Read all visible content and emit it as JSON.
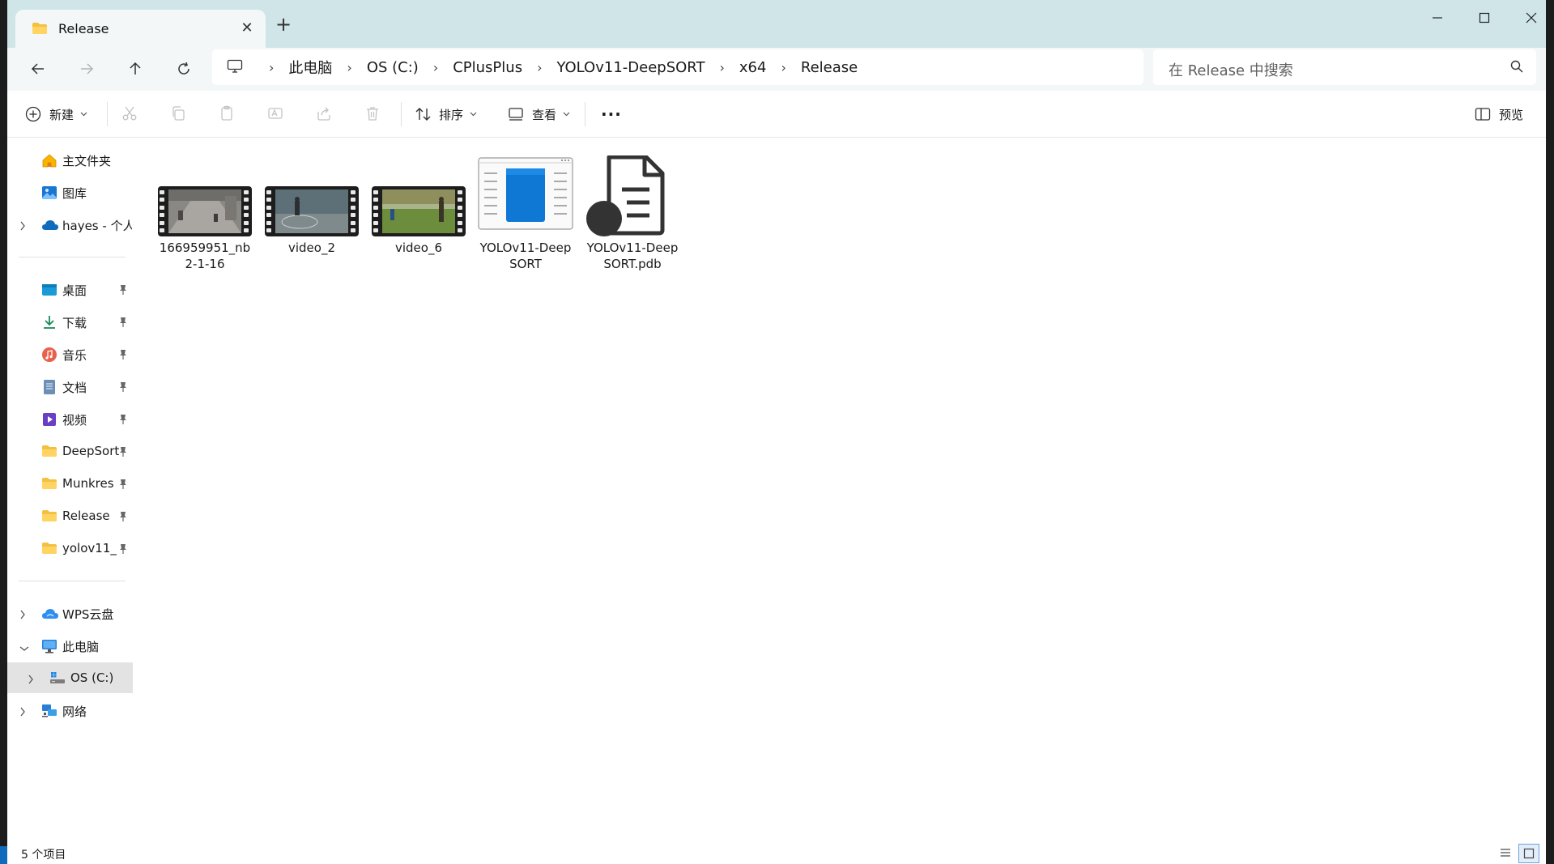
{
  "window": {
    "tab_title": "Release",
    "new_tab_label": "+",
    "close_tab_label": "✕"
  },
  "address": {
    "crumbs": [
      "此电脑",
      "OS (C:)",
      "CPlusPlus",
      "YOLOv11-DeepSORT",
      "x64",
      "Release"
    ],
    "search_placeholder": "在 Release 中搜索"
  },
  "toolbar": {
    "new_label": "新建",
    "sort_label": "排序",
    "view_label": "查看",
    "more_label": "···",
    "preview_label": "预览"
  },
  "sidebar": {
    "top": [
      {
        "label": "主文件夹",
        "icon": "home-icon"
      },
      {
        "label": "图库",
        "icon": "gallery-icon"
      },
      {
        "label": "hayes - 个人",
        "icon": "onedrive-cloud-icon"
      }
    ],
    "pinned": [
      {
        "label": "桌面",
        "icon": "desktop-icon"
      },
      {
        "label": "下载",
        "icon": "download-icon"
      },
      {
        "label": "音乐",
        "icon": "music-icon"
      },
      {
        "label": "文档",
        "icon": "document-icon"
      },
      {
        "label": "视频",
        "icon": "video-icon"
      },
      {
        "label": "DeepSort",
        "icon": "folder-icon"
      },
      {
        "label": "Munkres",
        "icon": "folder-icon"
      },
      {
        "label": "Release",
        "icon": "folder-icon"
      },
      {
        "label": "yolov11_",
        "icon": "folder-icon"
      }
    ],
    "bottom": [
      {
        "label": "WPS云盘",
        "icon": "wps-cloud-icon"
      },
      {
        "label": "此电脑",
        "icon": "computer-icon"
      },
      {
        "label": "OS (C:)",
        "icon": "drive-icon"
      },
      {
        "label": "网络",
        "icon": "network-icon"
      }
    ]
  },
  "files": [
    {
      "name": "166959951_nb2-1-16",
      "type": "video"
    },
    {
      "name": "video_2",
      "type": "video"
    },
    {
      "name": "video_6",
      "type": "video"
    },
    {
      "name": "YOLOv11-DeepSORT",
      "type": "exe"
    },
    {
      "name": "YOLOv11-DeepSORT.pdb",
      "type": "pdb"
    }
  ],
  "status": {
    "count": "5 个项目"
  },
  "colors": {
    "tabbar": "#cfe5e8",
    "navbar": "#f3f7f8",
    "selected": "#e3e3e3",
    "accent": "#0067c0"
  }
}
